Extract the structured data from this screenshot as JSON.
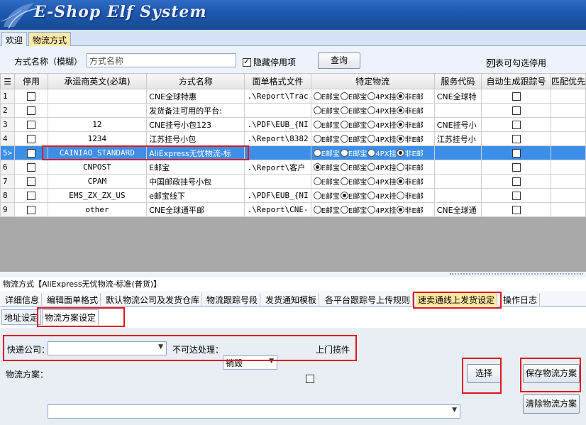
{
  "app": {
    "title": "E-Shop Elf System"
  },
  "top_tabs": [
    "欢迎",
    "物流方式"
  ],
  "toolbar": {
    "name_label": "方式名称（模糊）",
    "name_placeholder": "方式名称",
    "hide_disabled_label": "隐藏停用项",
    "hide_disabled_checked": true,
    "query_button": "查询",
    "list_select_label": "列表可勾选停用",
    "list_select_checked": false
  },
  "grid": {
    "columns": [
      "停用",
      "承运商英文(必填)",
      "方式名称",
      "面单格式文件",
      "特定物流",
      "服务代码",
      "自动生成跟踪号",
      "匹配优先"
    ],
    "radio_labels": [
      "E邮宝",
      "E邮宝",
      "4PX挂",
      "非E邮"
    ],
    "selected_row": 5,
    "rows": [
      {
        "num": "1",
        "stop": false,
        "carrier": "",
        "name": "CNE全球特惠",
        "format": ".\\Report\\Trac",
        "radio": 3,
        "service": "CNE全球特",
        "auto": false
      },
      {
        "num": "2",
        "stop": false,
        "carrier": "",
        "name": "发货备注可用的平台:",
        "format": "",
        "radio": 3,
        "service": "",
        "auto": false
      },
      {
        "num": "3",
        "stop": false,
        "carrier": "12",
        "name": "CNE挂号小包123",
        "format": ".\\PDF\\EUB_{NI",
        "radio": 3,
        "service": "CNE挂号小",
        "auto": false
      },
      {
        "num": "4",
        "stop": false,
        "carrier": "1234",
        "name": "江苏挂号小包",
        "format": ".\\Report\\8382",
        "radio": 3,
        "service": "江苏挂号小",
        "auto": false
      },
      {
        "num": "5>",
        "stop": false,
        "carrier": "CAINIAO_STANDARD",
        "name": "AliExpress无忧物流-标",
        "format": "",
        "radio": 3,
        "service": "",
        "auto": false
      },
      {
        "num": "6",
        "stop": false,
        "carrier": "CNPOST",
        "name": "E邮宝",
        "format": ".\\Report\\客户",
        "radio": 0,
        "service": "",
        "auto": false
      },
      {
        "num": "7",
        "stop": false,
        "carrier": "CPAM",
        "name": "中国邮政挂号小包",
        "format": "",
        "radio": 3,
        "service": "",
        "auto": false
      },
      {
        "num": "8",
        "stop": false,
        "carrier": "EMS_ZX_ZX_US",
        "name": "e邮宝线下",
        "format": ".\\PDF\\EUB_{NI",
        "radio": 1,
        "service": "",
        "auto": false
      },
      {
        "num": "9",
        "stop": false,
        "carrier": "other",
        "name": "CNE全球通平邮",
        "format": ".\\Report\\CNE-",
        "radio": 3,
        "service": "CNE全球通",
        "auto": false
      }
    ]
  },
  "detail": {
    "title": "物流方式【AliExpress无忧物流-标准(普货)】",
    "tabs": [
      "详细信息",
      "编辑面单格式",
      "默认物流公司及发货仓库",
      "物流跟踪号段",
      "发货通知模板",
      "各平台跟踪号上传规则",
      "速卖通线上发货设定",
      "操作日志"
    ],
    "active_tab": "速卖通线上发货设定",
    "sub_tabs": [
      "地址设定",
      "物流方案设定"
    ],
    "active_sub_tab": "物流方案设定",
    "courier_label": "快递公司：",
    "courier_value": "",
    "unreachable_label": "不可达处理：",
    "unreachable_value": "销毁",
    "pickup_label": "上门揽件",
    "pickup_checked": false,
    "plan_label": "物流方案：",
    "plan_value": "",
    "select_button": "选择",
    "save_button": "保存物流方案",
    "clear_button": "清除物流方案"
  },
  "colors": {
    "highlight": "#e0161e",
    "selected_row": "#3d8ee8",
    "banner": "#1d57ad"
  }
}
